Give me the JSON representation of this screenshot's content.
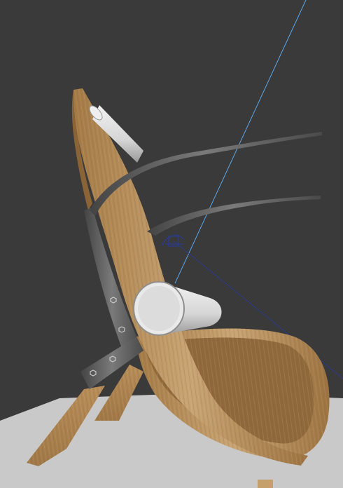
{
  "viewport": {
    "background": "#3a3a3a",
    "floor_color": "#c8c8c8",
    "wood_color": "#b58a55",
    "wood_light": "#caa77a",
    "wood_dark": "#8a6437",
    "metal_color": "#5c5c5c",
    "metal_light": "#9a9a9a",
    "cushion_color": "#e2e2e2",
    "light_line_color": "#5aa6e8",
    "camera_line_color": "#2b3b8c",
    "icons": [
      "light-target-icon",
      "bolt-icon"
    ]
  }
}
